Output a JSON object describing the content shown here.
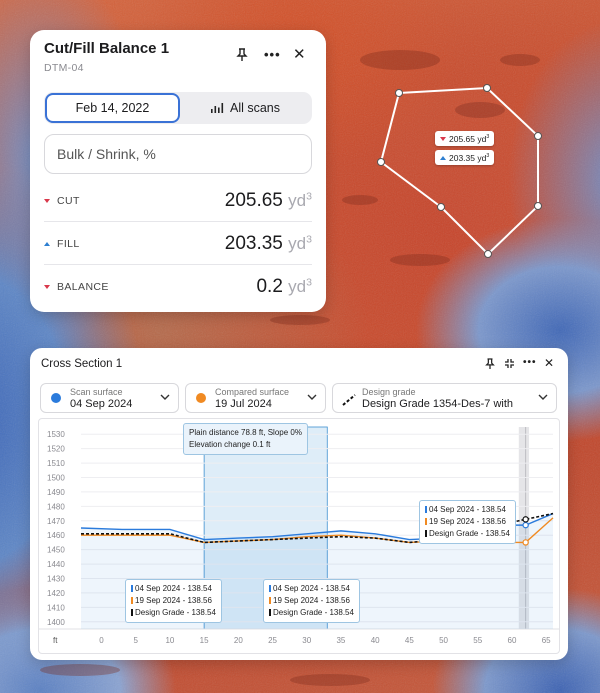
{
  "polygon": {
    "cut_badge": "205.65 yd",
    "fill_badge": "203.35 yd",
    "badge_unit_power": "3"
  },
  "cut_fill_card": {
    "title": "Cut/Fill Balance 1",
    "subtitle": "DTM-04",
    "icons": [
      "pin-icon",
      "more-icon",
      "close-icon"
    ],
    "date_tab": "Feb 14, 2022",
    "scans_tab": "All scans",
    "bulk_placeholder": "Bulk / Shrink, %",
    "rows": [
      {
        "label": "CUT",
        "value": "205.65",
        "unit": "yd",
        "power": "3",
        "indicator": "down"
      },
      {
        "label": "FILL",
        "value": "203.35",
        "unit": "yd",
        "power": "3",
        "indicator": "up"
      },
      {
        "label": "BALANCE",
        "value": "0.2",
        "unit": "yd",
        "power": "3",
        "indicator": "down"
      }
    ]
  },
  "cross_section": {
    "title": "Cross Section 1",
    "icons": [
      "pin-icon",
      "collapse-icon",
      "more-icon",
      "close-icon"
    ],
    "selectors": [
      {
        "label": "Scan surface",
        "value": "04 Sep 2024",
        "color": "#2b7bdc"
      },
      {
        "label": "Compared surface",
        "value": "19 Jul 2024",
        "color": "#f08a22"
      },
      {
        "label": "Design grade",
        "value": "Design Grade 1354-Des-7 with"
      }
    ],
    "info_tip": [
      "Plain distance 78.8 ft, Slope 0%",
      "Elevation change 0.1 ft"
    ],
    "point_tips": [
      [
        "04 Sep 2024 - 138.54",
        "19 Sep 2024 - 138.56",
        "Design Grade - 138.54"
      ],
      [
        "04 Sep 2024 - 138.54",
        "19 Sep 2024 - 138.56",
        "Design Grade - 138.54"
      ],
      [
        "04 Sep 2024 - 138.54",
        "19 Sep 2024 - 138.56",
        "Design Grade - 138.54"
      ]
    ]
  },
  "chart_data": {
    "type": "line",
    "xlabel": "ft",
    "ylabel": "",
    "xlim": [
      -3,
      66
    ],
    "ylim": [
      1395,
      1535
    ],
    "x_ticks": [
      0,
      5,
      10,
      15,
      20,
      25,
      30,
      35,
      40,
      45,
      50,
      55,
      60,
      65
    ],
    "y_ticks": [
      1400,
      1410,
      1420,
      1430,
      1440,
      1450,
      1460,
      1470,
      1480,
      1490,
      1500,
      1510,
      1520,
      1530
    ],
    "series": [
      {
        "name": "04 Sep 2024",
        "color": "#2b7bdc",
        "x": [
          -3,
          3,
          10,
          15,
          20,
          25,
          30,
          35,
          40,
          45,
          50,
          55,
          60,
          62,
          66
        ],
        "y": [
          1465,
          1464,
          1464,
          1457,
          1458,
          1459,
          1461,
          1463,
          1461,
          1457,
          1458,
          1462,
          1467,
          1467,
          1475
        ]
      },
      {
        "name": "19 Jul 2024",
        "color": "#f08a22",
        "x": [
          -3,
          3,
          10,
          15,
          20,
          25,
          30,
          35,
          40,
          45,
          50,
          55,
          60,
          62,
          66
        ],
        "y": [
          1460,
          1460,
          1460,
          1455,
          1456,
          1457,
          1459,
          1460,
          1458,
          1455,
          1456,
          1458,
          1455,
          1455,
          1472
        ]
      },
      {
        "name": "Design Grade 1354-Des-7",
        "color": "#111111",
        "dashed": true,
        "x": [
          -3,
          3,
          10,
          15,
          20,
          25,
          30,
          35,
          40,
          45,
          50,
          55,
          60,
          62,
          66
        ],
        "y": [
          1461,
          1461,
          1461,
          1455,
          1456,
          1457,
          1458,
          1459,
          1458,
          1455,
          1457,
          1460,
          1469,
          1471,
          1475
        ]
      }
    ]
  }
}
